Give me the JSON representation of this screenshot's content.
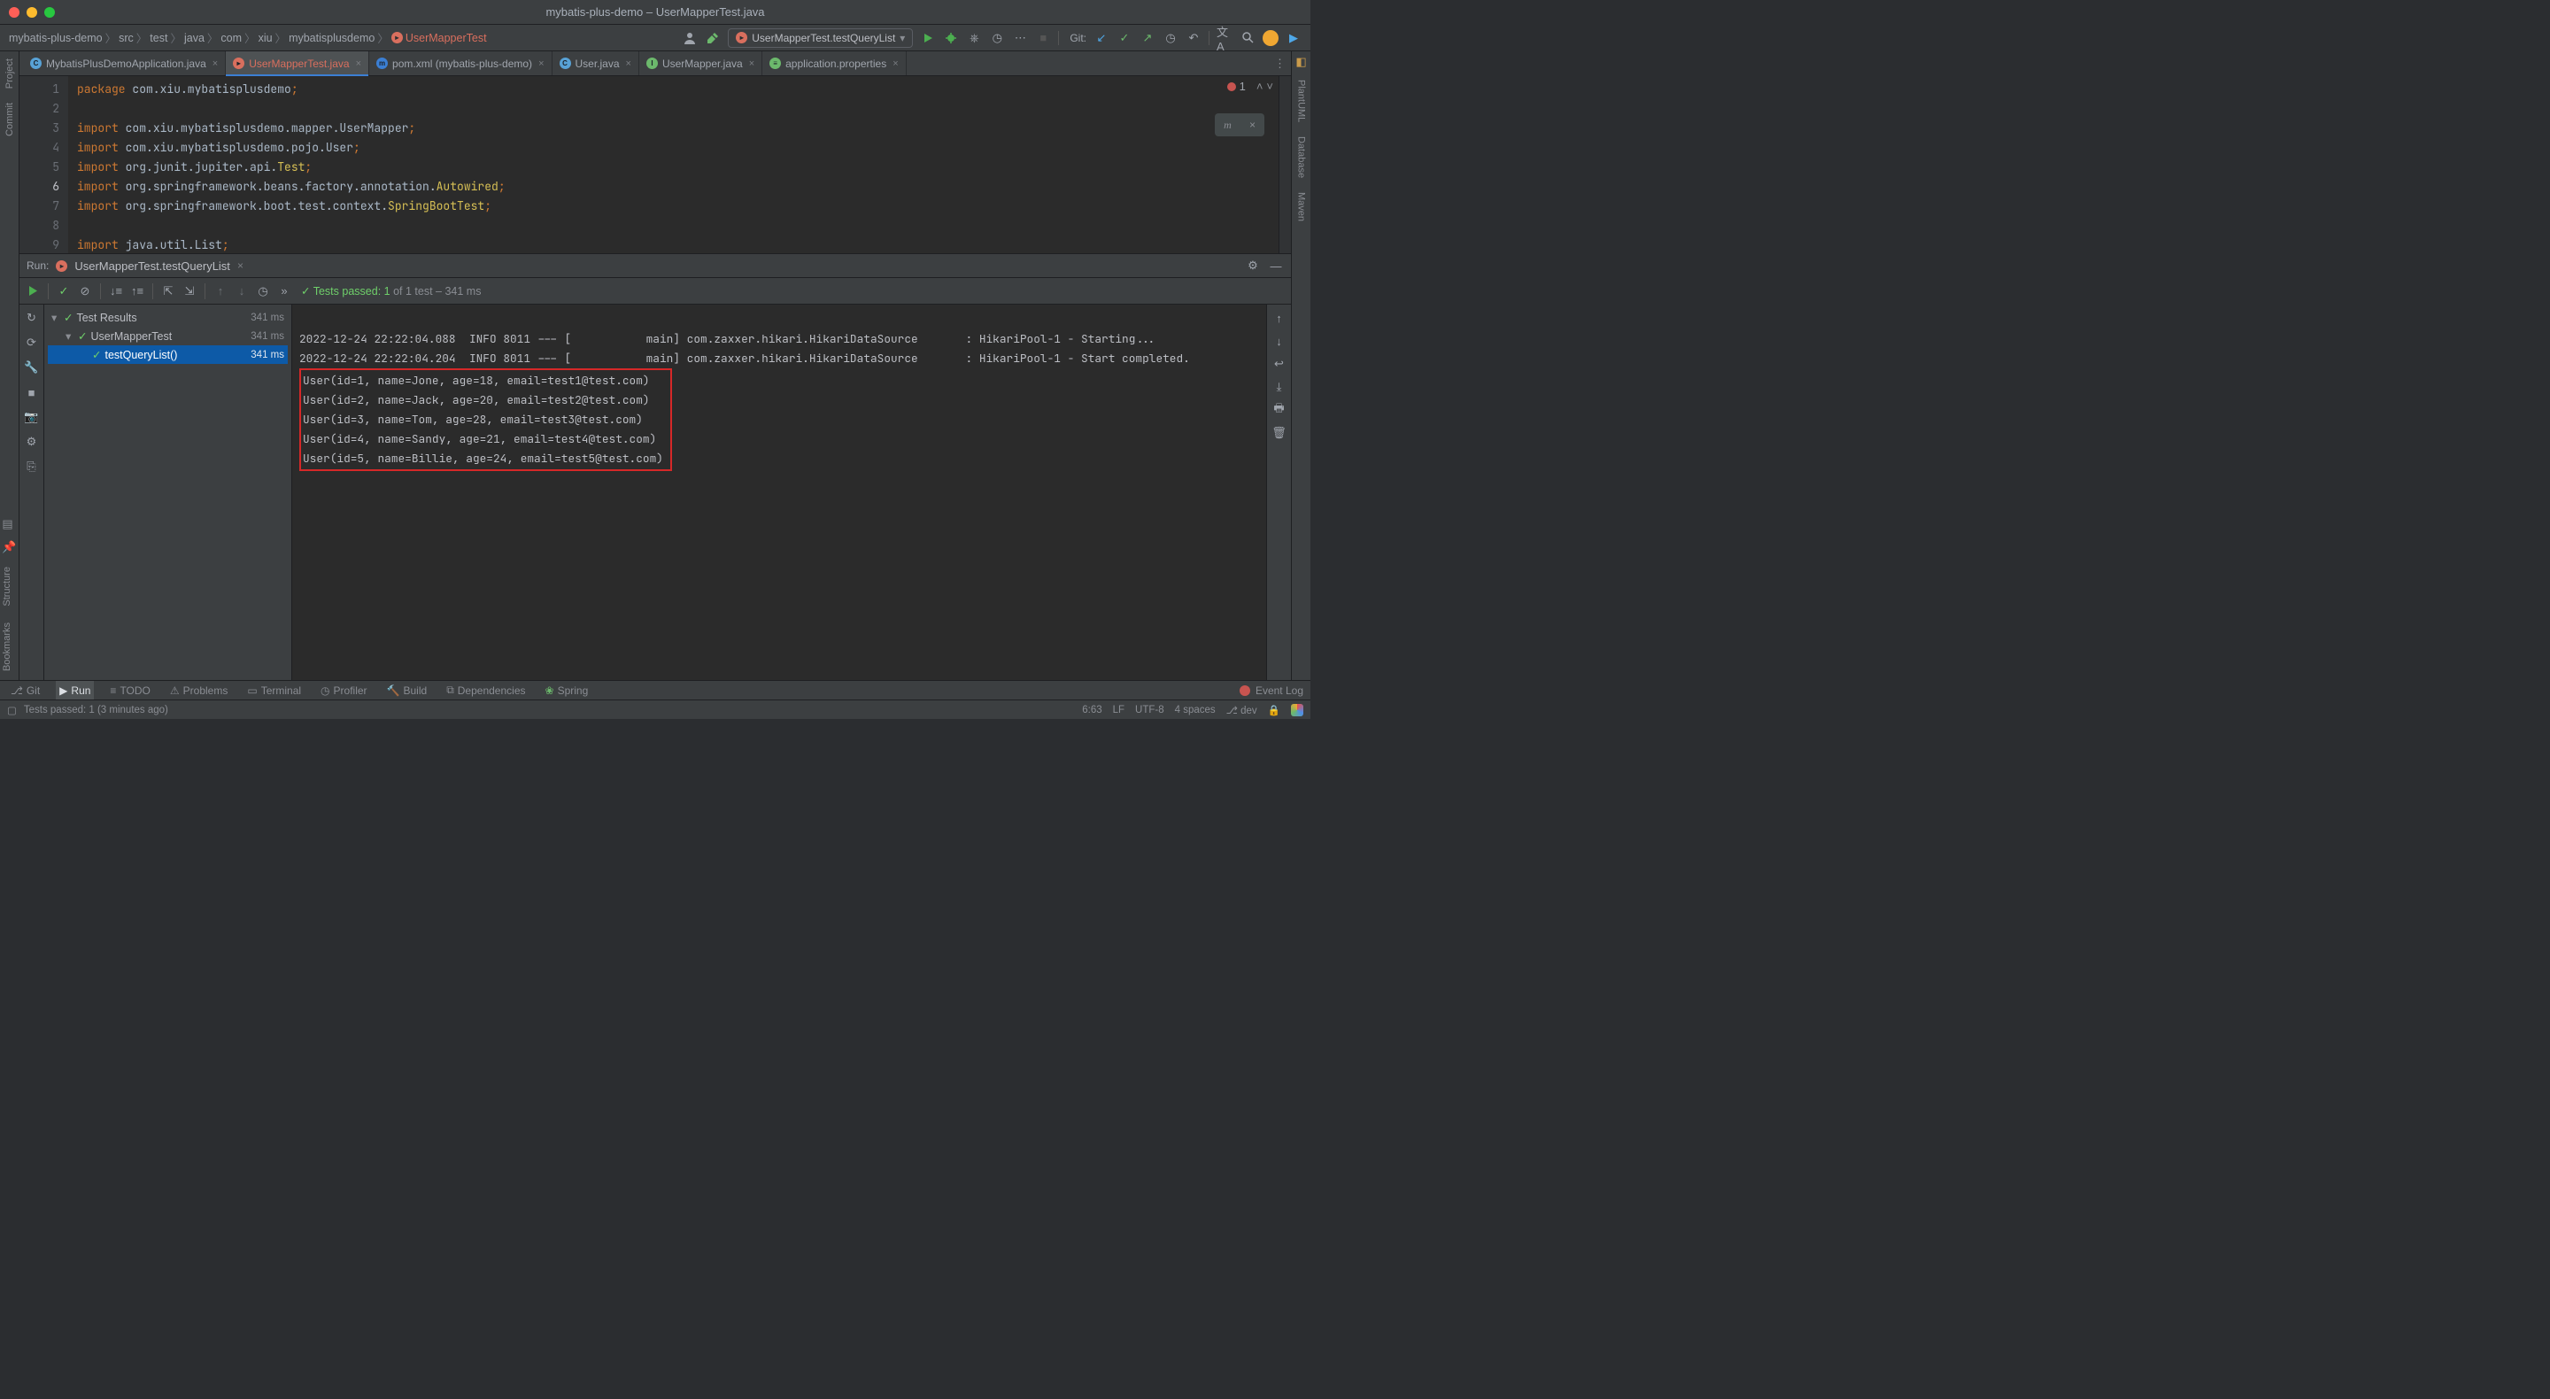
{
  "window": {
    "title": "mybatis-plus-demo – UserMapperTest.java"
  },
  "breadcrumb": {
    "items": [
      "mybatis-plus-demo",
      "src",
      "test",
      "java",
      "com",
      "xiu",
      "mybatisplusdemo"
    ],
    "active": "UserMapperTest"
  },
  "runConfig": {
    "label": "UserMapperTest.testQueryList"
  },
  "gitLabel": "Git:",
  "tabs": [
    {
      "label": "MybatisPlusDemoApplication.java",
      "kind": "class"
    },
    {
      "label": "UserMapperTest.java",
      "kind": "test",
      "active": true
    },
    {
      "label": "pom.xml (mybatis-plus-demo)",
      "kind": "maven"
    },
    {
      "label": "User.java",
      "kind": "class"
    },
    {
      "label": "UserMapper.java",
      "kind": "interface"
    },
    {
      "label": "application.properties",
      "kind": "props"
    }
  ],
  "code": {
    "lines": [
      {
        "n": 1,
        "html": "<span class='kw'>package</span> com.xiu.mybatisplusdemo<span class='punct'>;</span>"
      },
      {
        "n": 2,
        "html": ""
      },
      {
        "n": 3,
        "html": "<span class='kw'>import</span> com.xiu.mybatisplusdemo.mapper.UserMapper<span class='punct'>;</span>"
      },
      {
        "n": 4,
        "html": "<span class='kw'>import</span> com.xiu.mybatisplusdemo.pojo.User<span class='punct'>;</span>"
      },
      {
        "n": 5,
        "html": "<span class='kw'>import</span> org.junit.jupiter.api.<span class='cls'>Test</span><span class='punct'>;</span>"
      },
      {
        "n": 6,
        "html": "<span class='kw'>import</span> org.springframework.beans.factory.annotation.<span class='cls'>Autowired</span><span class='punct'>;</span>",
        "active": true
      },
      {
        "n": 7,
        "html": "<span class='kw'>import</span> org.springframework.boot.test.context.<span class='cls'>SpringBootTest</span><span class='punct'>;</span>"
      },
      {
        "n": 8,
        "html": ""
      },
      {
        "n": 9,
        "html": "<span class='kw'>import</span> java.util.List<span class='punct'>;</span>"
      }
    ],
    "errorCount": "1"
  },
  "run": {
    "label": "Run:",
    "name": "UserMapperTest.testQueryList",
    "statusPassed": "Tests passed:",
    "statusCount": "1",
    "statusRest": "of 1 test – 341 ms",
    "tree": [
      {
        "label": "Test Results",
        "time": "341 ms",
        "depth": 0
      },
      {
        "label": "UserMapperTest",
        "time": "341 ms",
        "depth": 1
      },
      {
        "label": "testQueryList()",
        "time": "341 ms",
        "depth": 2,
        "selected": true
      }
    ],
    "console": {
      "log1": "2022-12-24 22:22:04.088  INFO 8011 --- [           main] com.zaxxer.hikari.HikariDataSource       : HikariPool-1 - Starting...",
      "log2": "2022-12-24 22:22:04.204  INFO 8011 --- [           main] com.zaxxer.hikari.HikariDataSource       : HikariPool-1 - Start completed.",
      "boxed": [
        "User(id=1, name=Jone, age=18, email=test1@test.com)",
        "User(id=2, name=Jack, age=20, email=test2@test.com)",
        "User(id=3, name=Tom, age=28, email=test3@test.com)",
        "User(id=4, name=Sandy, age=21, email=test4@test.com)",
        "User(id=5, name=Billie, age=24, email=test5@test.com)"
      ]
    }
  },
  "leftTools": {
    "project": "Project",
    "commit": "Commit",
    "structure": "Structure",
    "bookmarks": "Bookmarks"
  },
  "rightTools": {
    "plantuml": "PlantUML",
    "database": "Database",
    "maven": "Maven"
  },
  "bottomTabs": {
    "git": "Git",
    "run": "Run",
    "todo": "TODO",
    "problems": "Problems",
    "terminal": "Terminal",
    "profiler": "Profiler",
    "build": "Build",
    "dependencies": "Dependencies",
    "spring": "Spring",
    "eventLog": "Event Log"
  },
  "status": {
    "left": "Tests passed: 1 (3 minutes ago)",
    "caret": "6:63",
    "le": "LF",
    "enc": "UTF-8",
    "indent": "4 spaces",
    "branch": "dev"
  }
}
